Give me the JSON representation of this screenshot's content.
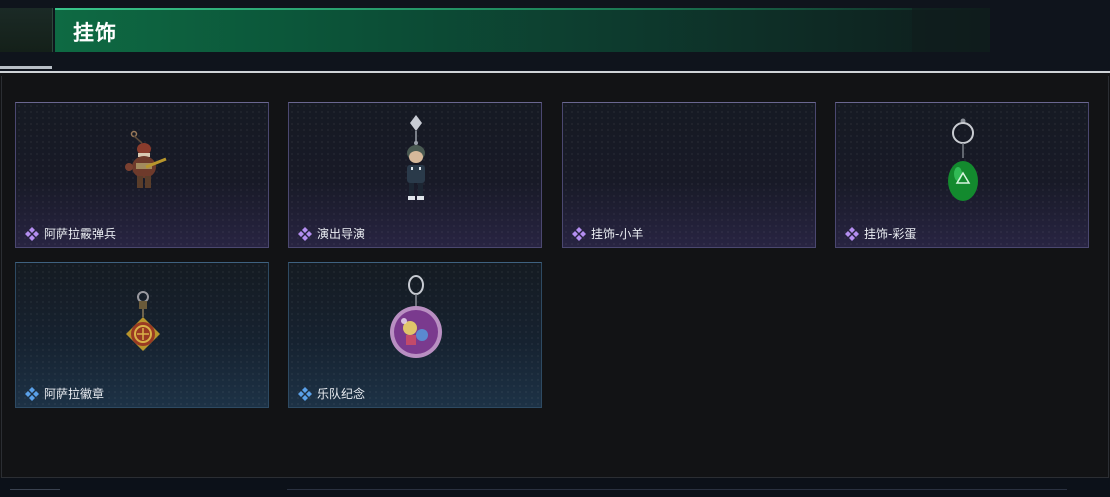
{
  "header": {
    "title": "挂饰"
  },
  "rarity_colors": {
    "purple": "#b48ef0",
    "blue": "#5aa0e8"
  },
  "items": [
    {
      "name": "阿萨拉霰弹兵",
      "rarity": "purple",
      "icon": "soldier-charm-icon"
    },
    {
      "name": "演出导演",
      "rarity": "purple",
      "icon": "director-figure-charm-icon"
    },
    {
      "name": "挂饰-小羊",
      "rarity": "purple",
      "icon": "lamb-charm-icon"
    },
    {
      "name": "挂饰-彩蛋",
      "rarity": "purple",
      "icon": "green-egg-charm-icon"
    },
    {
      "name": "阿萨拉徽章",
      "rarity": "blue",
      "icon": "badge-medallion-charm-icon"
    },
    {
      "name": "乐队纪念",
      "rarity": "blue",
      "icon": "band-pin-charm-icon"
    }
  ]
}
